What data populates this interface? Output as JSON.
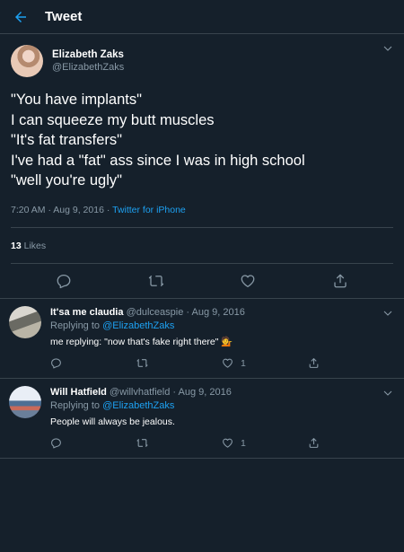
{
  "header": {
    "title": "Tweet"
  },
  "tweet": {
    "author_name": "Elizabeth Zaks",
    "author_handle": "@ElizabethZaks",
    "lines": [
      "\"You have implants\"",
      "I can squeeze my butt muscles",
      "\"It's fat transfers\"",
      "I've had a \"fat\" ass since I was in high school",
      "\"well you're ugly\""
    ],
    "time_date": "7:20 AM · Aug 9, 2016 · ",
    "source": "Twitter for iPhone",
    "likes_count": "13",
    "likes_label": "Likes"
  },
  "replies": [
    {
      "name": "It'sa me claudia",
      "handle": "@dulceaspie",
      "date": "· Aug 9, 2016",
      "replying_prefix": "Replying to ",
      "replying_to": "@ElizabethZaks",
      "text": "me replying: \"now that's fake right there\" 💁",
      "like_count": "1"
    },
    {
      "name": "Will Hatfield",
      "handle": "@willvhatfield",
      "date": "· Aug 9, 2016",
      "replying_prefix": "Replying to ",
      "replying_to": "@ElizabethZaks",
      "text": "People will always be jealous.",
      "like_count": "1"
    }
  ],
  "icons": {
    "back": "arrow-left-icon",
    "more": "chevron-down-icon",
    "reply": "reply-icon",
    "retweet": "retweet-icon",
    "like": "heart-icon",
    "share": "share-icon"
  },
  "colors": {
    "background": "#15202b",
    "accent": "#1da1f2",
    "muted": "#8899a6",
    "divider": "#38444d"
  }
}
